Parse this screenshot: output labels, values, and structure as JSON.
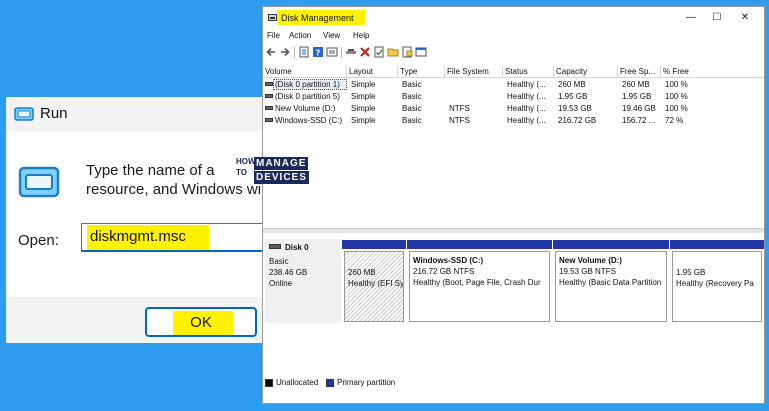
{
  "run_dialog": {
    "title": "Run",
    "description": "Type the name of a\nresource, and Windows wi",
    "open_label": "Open:",
    "input_value": "diskmgmt.msc",
    "ok_label": "OK"
  },
  "logo": {
    "how": "HOW",
    "to": "TO",
    "manage": "MANAGE",
    "devices": "DEVICES"
  },
  "disk_management": {
    "title": "Disk Management",
    "window_controls": {
      "minimize": "—",
      "maximize": "☐",
      "close": "✕"
    },
    "menu": [
      "File",
      "Action",
      "View",
      "Help"
    ],
    "toolbar_icons": [
      "back-arrow-icon",
      "forward-arrow-icon",
      "properties-icon",
      "help-icon",
      "list-view-icon",
      "connect-icon",
      "delete-icon",
      "check-icon",
      "folder-icon",
      "rescan-icon",
      "panel-icon"
    ],
    "columns": [
      "Volume",
      "Layout",
      "Type",
      "File System",
      "Status",
      "Capacity",
      "Free Sp...",
      "% Free"
    ],
    "rows": [
      [
        "(Disk 0 partition 1)",
        "Simple",
        "Basic",
        "",
        "Healthy (...",
        "260 MB",
        "260 MB",
        "100 %"
      ],
      [
        "(Disk 0 partition 5)",
        "Simple",
        "Basic",
        "",
        "Healthy (...",
        "1.95 GB",
        "1.95 GB",
        "100 %"
      ],
      [
        "New Volume (D:)",
        "Simple",
        "Basic",
        "NTFS",
        "Healthy (...",
        "19.53 GB",
        "19.46 GB",
        "100 %"
      ],
      [
        "Windows-SSD (C:)",
        "Simple",
        "Basic",
        "NTFS",
        "Healthy (...",
        "216.72 GB",
        "156.72 ...",
        "72 %"
      ]
    ],
    "disk": {
      "name": "Disk 0",
      "type": "Basic",
      "size": "238.46 GB",
      "status": "Online"
    },
    "partitions": [
      {
        "name": "",
        "size": "260 MB",
        "status": "Healthy (EFI Sy"
      },
      {
        "name": "Windows-SSD  (C:)",
        "size": "216.72 GB NTFS",
        "status": "Healthy (Boot, Page File, Crash Dur"
      },
      {
        "name": "New Volume  (D:)",
        "size": "19.53 GB NTFS",
        "status": "Healthy (Basic Data Partition"
      },
      {
        "name": "",
        "size": "1.95 GB",
        "status": "Healthy (Recovery Pa"
      }
    ],
    "legend": [
      {
        "label": "Unallocated",
        "color": "#000000"
      },
      {
        "label": "Primary partition",
        "color": "#2336a8"
      }
    ]
  }
}
